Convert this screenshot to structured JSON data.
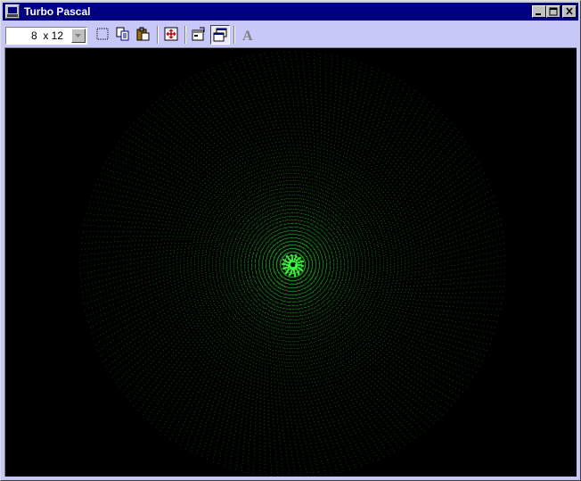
{
  "window": {
    "title": "Turbo Pascal",
    "icon": "terminal-computer-icon",
    "controls": [
      "minimize-icon",
      "maximize-icon",
      "close-icon"
    ]
  },
  "toolbar": {
    "font_size": {
      "value": "8  x 12",
      "options_visible": false
    },
    "buttons": [
      {
        "name": "mark",
        "icon": "mark-selection-icon"
      },
      {
        "name": "copy",
        "icon": "copy-icon"
      },
      {
        "name": "paste",
        "icon": "paste-icon"
      },
      {
        "name": "full-screen",
        "icon": "full-screen-icon"
      },
      {
        "name": "properties",
        "icon": "properties-icon"
      },
      {
        "name": "background",
        "icon": "background-icon",
        "pressed": true
      },
      {
        "name": "font",
        "icon": "font-icon",
        "label": "A"
      }
    ]
  },
  "canvas": {
    "background": "#000000",
    "dot_color": "#1fbf1f",
    "center_color": "#3cff3c",
    "content": "green-dot-spiral-graphic"
  },
  "colors": {
    "titlebar": "#000080",
    "frame": "#c8c8f8",
    "button_face": "#c0c0c0"
  }
}
